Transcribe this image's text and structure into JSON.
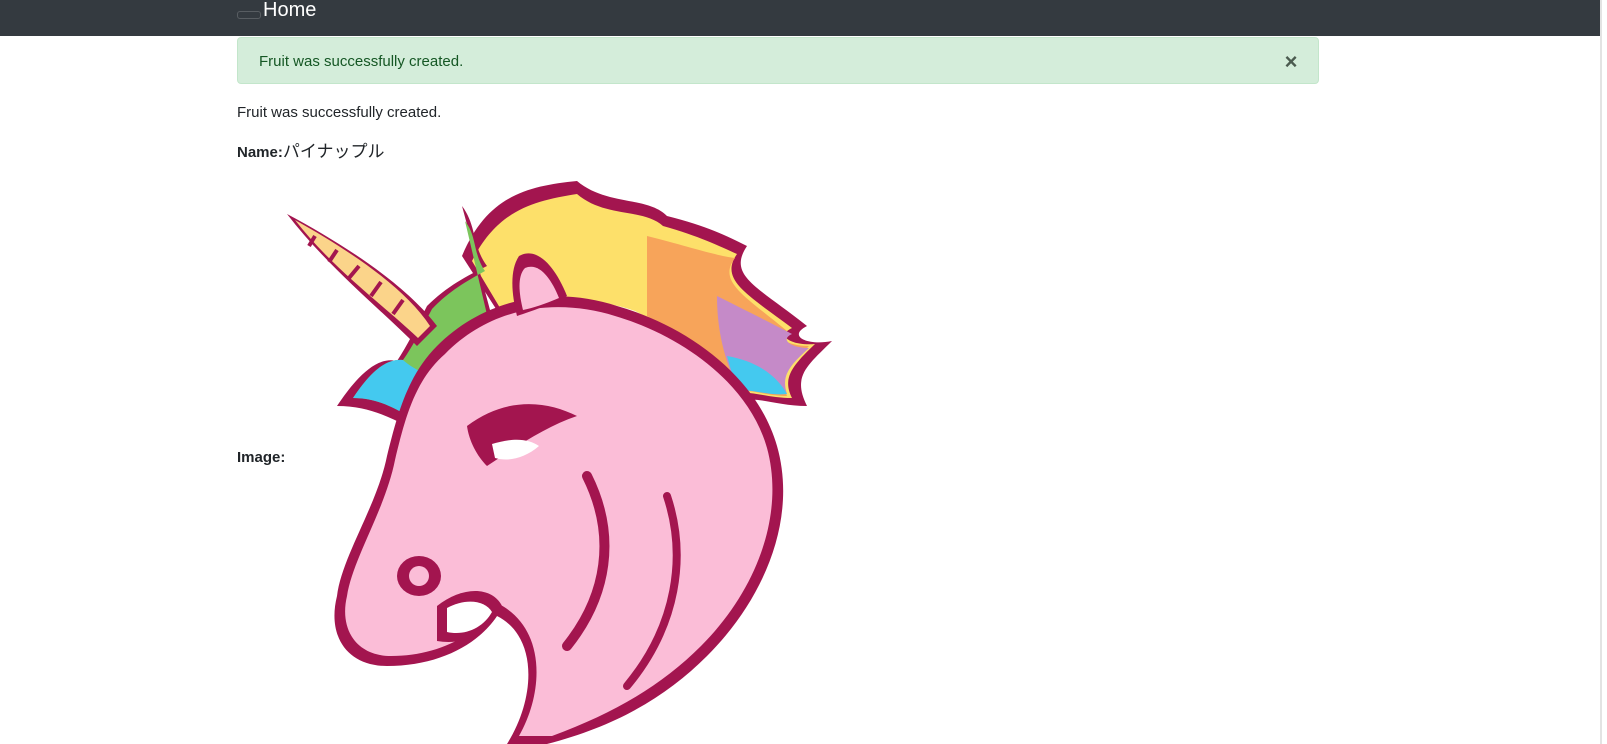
{
  "navbar": {
    "brand": "Home"
  },
  "alert": {
    "message": "Fruit was successfully created.",
    "close_glyph": "×"
  },
  "notice": "Fruit was successfully created.",
  "fruit": {
    "name_label": "Name:",
    "name_value": "パイナップル",
    "image_label": "Image:",
    "image_subject": "unicorn-head-illustration"
  },
  "colors": {
    "navbar_bg": "#343a40",
    "alert_bg": "#d4edda",
    "alert_text": "#155724",
    "unicorn_outline": "#a3154f",
    "unicorn_body": "#fbbdd7"
  }
}
